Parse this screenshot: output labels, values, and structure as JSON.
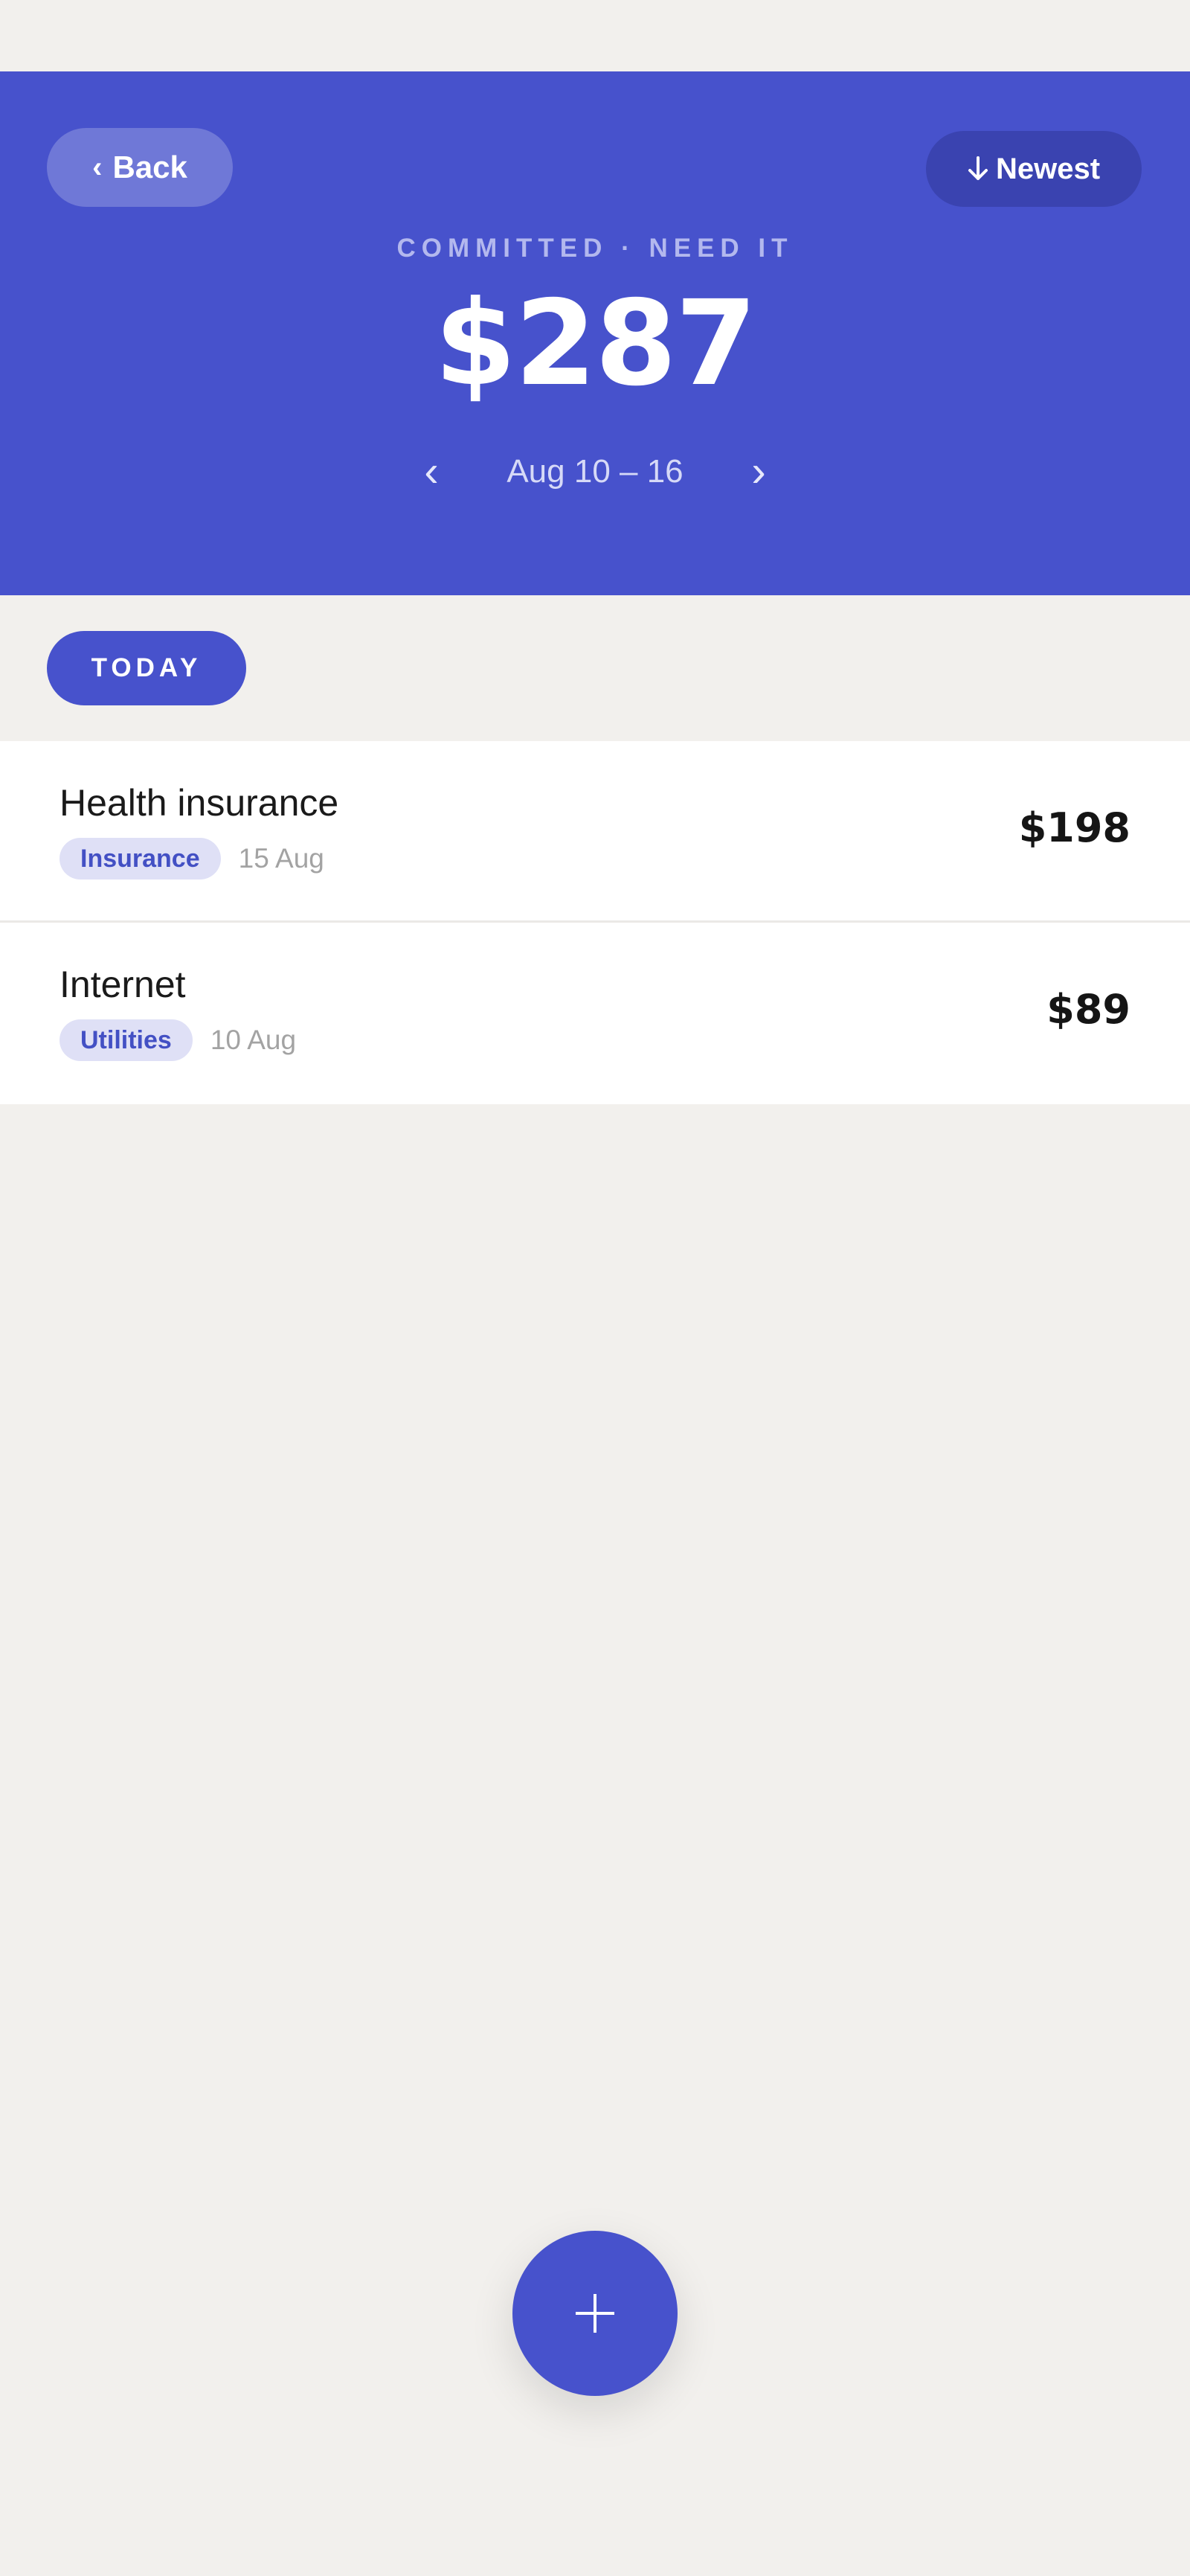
{
  "header": {
    "back_label": "Back",
    "sort_label": "Newest",
    "subtitle": "COMMITTED · NEED IT",
    "total": "$287",
    "week_range": "Aug 10 – 16"
  },
  "section": {
    "label": "TODAY"
  },
  "transactions": [
    {
      "title": "Health insurance",
      "category": "Insurance",
      "date": "15 Aug",
      "amount": "$198"
    },
    {
      "title": "Internet",
      "category": "Utilities",
      "date": "10 Aug",
      "amount": "$89"
    }
  ],
  "icons": {
    "back": "chevron-left-icon",
    "sort": "arrow-down-icon",
    "prev_week": "chevron-left-icon",
    "next_week": "chevron-right-icon",
    "add": "plus-icon"
  },
  "colors": {
    "accent": "#4752cc",
    "background": "#f2f0ed",
    "tag_bg": "#dfe0f6",
    "tag_text": "#4350c4"
  }
}
